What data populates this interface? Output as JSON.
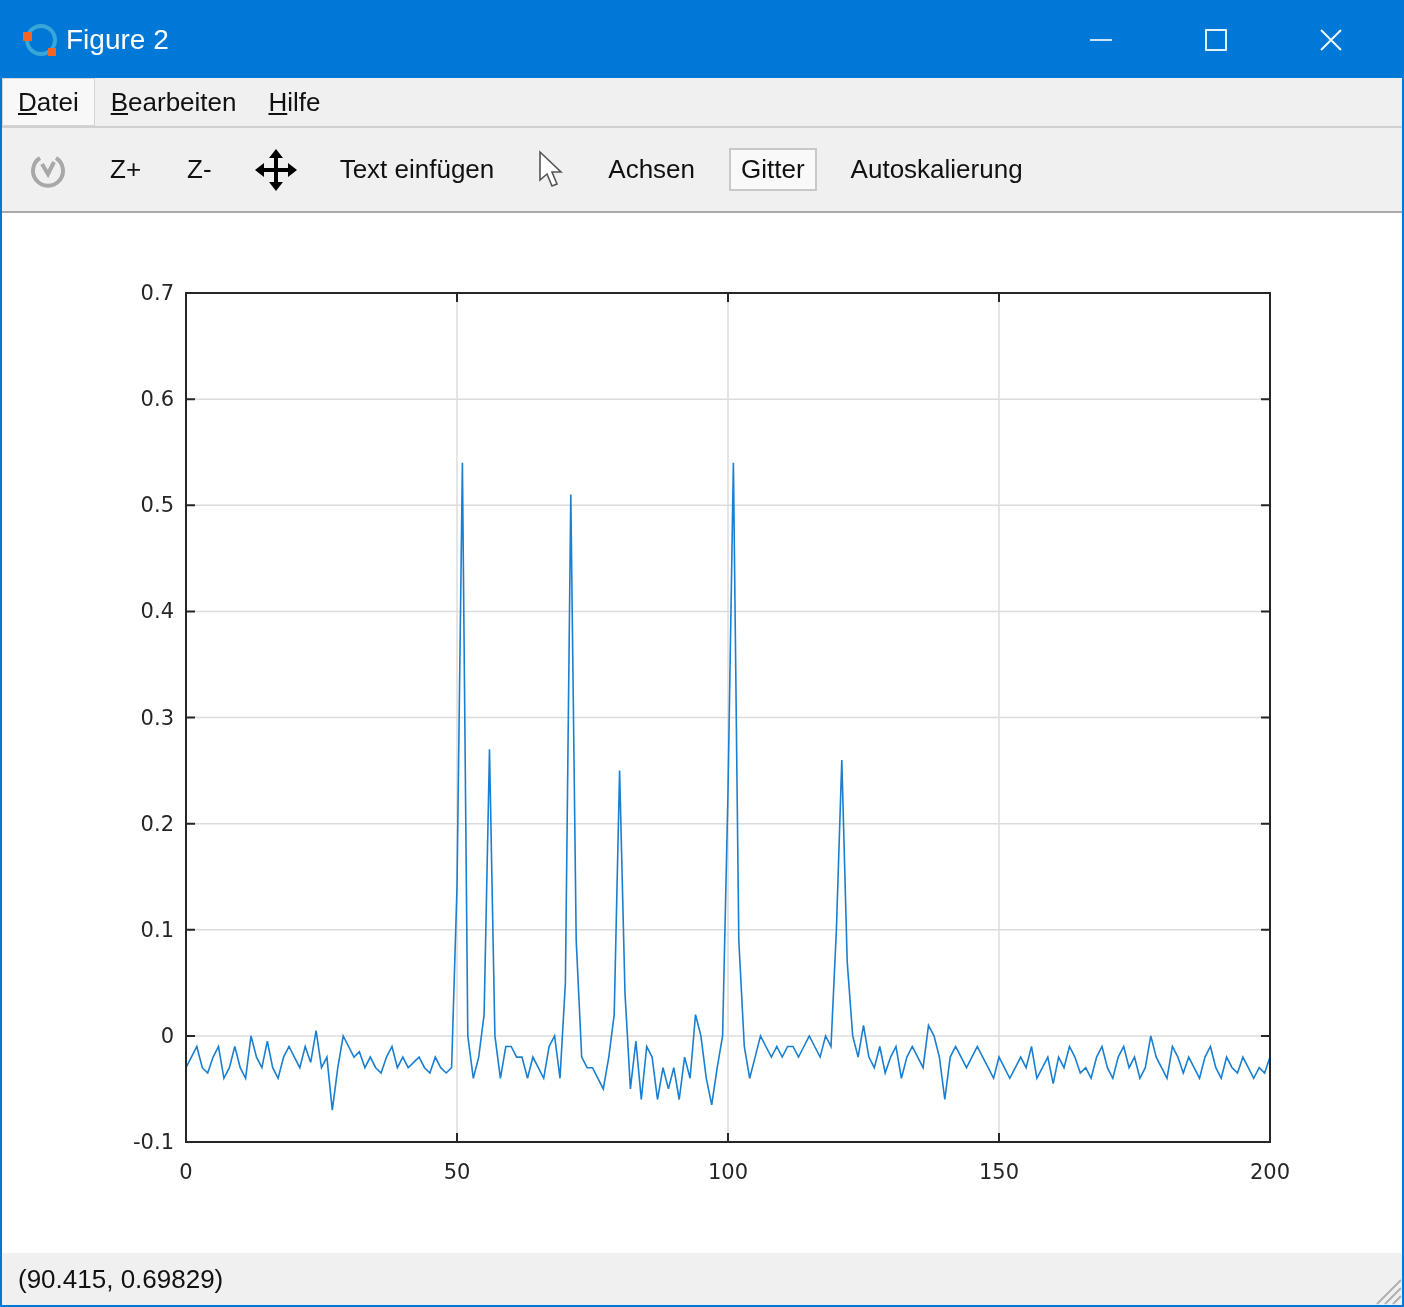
{
  "window": {
    "title": "Figure 2"
  },
  "menu": [
    {
      "label": "Datei",
      "selected": true
    },
    {
      "label": "Bearbeiten",
      "selected": false
    },
    {
      "label": "Hilfe",
      "selected": false
    }
  ],
  "toolbar": [
    {
      "kind": "rotate",
      "disabled": true,
      "selected": false
    },
    {
      "kind": "text",
      "label": "Z+",
      "disabled": false,
      "selected": false
    },
    {
      "kind": "text",
      "label": "Z-",
      "disabled": false,
      "selected": false
    },
    {
      "kind": "pan",
      "disabled": false,
      "selected": false
    },
    {
      "kind": "text",
      "label": "Text einfügen",
      "disabled": false,
      "selected": false
    },
    {
      "kind": "pointer",
      "disabled": false,
      "selected": false
    },
    {
      "kind": "text",
      "label": "Achsen",
      "disabled": false,
      "selected": false
    },
    {
      "kind": "text",
      "label": "Gitter",
      "disabled": false,
      "selected": true
    },
    {
      "kind": "text",
      "label": "Autoskalierung",
      "disabled": false,
      "selected": false
    }
  ],
  "plot": {
    "chart_data": {
      "type": "line",
      "grid": true,
      "xlim": [
        0,
        200
      ],
      "ylim": [
        -0.1,
        0.7
      ],
      "xticks": [
        0,
        50,
        100,
        150,
        200
      ],
      "yticks": [
        -0.1,
        0,
        0.1,
        0.2,
        0.3,
        0.4,
        0.5,
        0.6,
        0.7
      ],
      "x": [
        0,
        1,
        2,
        3,
        4,
        5,
        6,
        7,
        8,
        9,
        10,
        11,
        12,
        13,
        14,
        15,
        16,
        17,
        18,
        19,
        20,
        21,
        22,
        23,
        24,
        25,
        26,
        27,
        28,
        29,
        30,
        31,
        32,
        33,
        34,
        35,
        36,
        37,
        38,
        39,
        40,
        41,
        42,
        43,
        44,
        45,
        46,
        47,
        48,
        49,
        50,
        51,
        52,
        53,
        54,
        55,
        56,
        57,
        58,
        59,
        60,
        61,
        62,
        63,
        64,
        65,
        66,
        67,
        68,
        69,
        70,
        71,
        72,
        73,
        74,
        75,
        76,
        77,
        78,
        79,
        80,
        81,
        82,
        83,
        84,
        85,
        86,
        87,
        88,
        89,
        90,
        91,
        92,
        93,
        94,
        95,
        96,
        97,
        98,
        99,
        100,
        101,
        102,
        103,
        104,
        105,
        106,
        107,
        108,
        109,
        110,
        111,
        112,
        113,
        114,
        115,
        116,
        117,
        118,
        119,
        120,
        121,
        122,
        123,
        124,
        125,
        126,
        127,
        128,
        129,
        130,
        131,
        132,
        133,
        134,
        135,
        136,
        137,
        138,
        139,
        140,
        141,
        142,
        143,
        144,
        145,
        146,
        147,
        148,
        149,
        150,
        151,
        152,
        153,
        154,
        155,
        156,
        157,
        158,
        159,
        160,
        161,
        162,
        163,
        164,
        165,
        166,
        167,
        168,
        169,
        170,
        171,
        172,
        173,
        174,
        175,
        176,
        177,
        178,
        179,
        180,
        181,
        182,
        183,
        184,
        185,
        186,
        187,
        188,
        189,
        190,
        191,
        192,
        193,
        194,
        195,
        196,
        197,
        198,
        199,
        200
      ],
      "series": [
        {
          "color": "#1a7fd0",
          "values": [
            -0.03,
            -0.02,
            -0.01,
            -0.03,
            -0.035,
            -0.02,
            -0.01,
            -0.04,
            -0.03,
            -0.01,
            -0.03,
            -0.04,
            0.0,
            -0.02,
            -0.03,
            -0.005,
            -0.03,
            -0.04,
            -0.02,
            -0.01,
            -0.02,
            -0.03,
            -0.01,
            -0.025,
            0.005,
            -0.03,
            -0.02,
            -0.07,
            -0.03,
            0.0,
            -0.01,
            -0.02,
            -0.015,
            -0.03,
            -0.02,
            -0.03,
            -0.035,
            -0.02,
            -0.01,
            -0.03,
            -0.02,
            -0.03,
            -0.025,
            -0.02,
            -0.03,
            -0.035,
            -0.02,
            -0.03,
            -0.035,
            -0.03,
            0.14,
            0.54,
            0.0,
            -0.04,
            -0.02,
            0.02,
            0.27,
            0.0,
            -0.04,
            -0.01,
            -0.01,
            -0.02,
            -0.02,
            -0.04,
            -0.02,
            -0.03,
            -0.04,
            -0.01,
            0.0,
            -0.04,
            0.05,
            0.51,
            0.09,
            -0.02,
            -0.03,
            -0.03,
            -0.04,
            -0.05,
            -0.02,
            0.02,
            0.25,
            0.04,
            -0.05,
            -0.005,
            -0.06,
            -0.01,
            -0.02,
            -0.06,
            -0.03,
            -0.05,
            -0.03,
            -0.06,
            -0.02,
            -0.04,
            0.02,
            0.0,
            -0.04,
            -0.065,
            -0.03,
            0.0,
            0.23,
            0.54,
            0.09,
            -0.01,
            -0.04,
            -0.02,
            0.0,
            -0.01,
            -0.02,
            -0.01,
            -0.02,
            -0.01,
            -0.01,
            -0.02,
            -0.01,
            0.0,
            -0.01,
            -0.02,
            0.0,
            -0.01,
            0.1,
            0.26,
            0.07,
            0.0,
            -0.02,
            0.01,
            -0.02,
            -0.03,
            -0.01,
            -0.035,
            -0.02,
            -0.01,
            -0.04,
            -0.02,
            -0.01,
            -0.02,
            -0.03,
            0.01,
            0.0,
            -0.02,
            -0.06,
            -0.02,
            -0.01,
            -0.02,
            -0.03,
            -0.02,
            -0.01,
            -0.02,
            -0.03,
            -0.04,
            -0.02,
            -0.03,
            -0.04,
            -0.03,
            -0.02,
            -0.03,
            -0.01,
            -0.04,
            -0.03,
            -0.02,
            -0.045,
            -0.02,
            -0.03,
            -0.01,
            -0.02,
            -0.035,
            -0.03,
            -0.04,
            -0.02,
            -0.01,
            -0.03,
            -0.04,
            -0.02,
            -0.01,
            -0.03,
            -0.02,
            -0.04,
            -0.03,
            0.0,
            -0.02,
            -0.03,
            -0.04,
            -0.01,
            -0.02,
            -0.035,
            -0.02,
            -0.03,
            -0.04,
            -0.02,
            -0.01,
            -0.03,
            -0.04,
            -0.02,
            -0.03,
            -0.035,
            -0.02,
            -0.03,
            -0.04,
            -0.03,
            -0.035,
            -0.02
          ]
        }
      ]
    }
  },
  "status_bar": {
    "text": "(90.415, 0.69829)"
  }
}
